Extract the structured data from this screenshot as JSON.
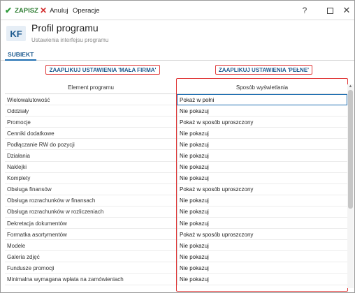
{
  "toolbar": {
    "save_label": "ZAPISZ",
    "cancel_label": "Anuluj",
    "operations_label": "Operacje",
    "help_label": "?"
  },
  "header": {
    "badge": "KF",
    "title": "Profil programu",
    "subtitle": "Ustawienia interfejsu programu"
  },
  "tabs": [
    {
      "label": "SUBIEKT"
    }
  ],
  "actions": {
    "apply_small": "ZAAPLIKUJ USTAWIENIA 'MAŁA FIRMA'",
    "apply_full": "ZAAPLIKUJ USTAWIENIA 'PEŁNE'"
  },
  "grid": {
    "columns": [
      "Element programu",
      "Sposób wyświetlania"
    ],
    "rows": [
      {
        "element": "Wielowalutowość",
        "mode": "Pokaż w pełni"
      },
      {
        "element": "Oddziały",
        "mode": "Nie pokazuj"
      },
      {
        "element": "Promocje",
        "mode": "Pokaż w sposób uproszczony"
      },
      {
        "element": "Cenniki dodatkowe",
        "mode": "Nie pokazuj"
      },
      {
        "element": "Podłączanie RW do pozycji",
        "mode": "Nie pokazuj"
      },
      {
        "element": "Działania",
        "mode": "Nie pokazuj"
      },
      {
        "element": "Naklejki",
        "mode": "Nie pokazuj"
      },
      {
        "element": "Komplety",
        "mode": "Nie pokazuj"
      },
      {
        "element": "Obsługa finansów",
        "mode": "Pokaż w sposób uproszczony"
      },
      {
        "element": "Obsługa rozrachunków w finansach",
        "mode": "Nie pokazuj"
      },
      {
        "element": "Obsługa rozrachunków w rozliczeniach",
        "mode": "Nie pokazuj"
      },
      {
        "element": "Dekretacja dokumentów",
        "mode": "Nie pokazuj"
      },
      {
        "element": "Formatka asortymentów",
        "mode": "Pokaż w sposób uproszczony"
      },
      {
        "element": "Modele",
        "mode": "Nie pokazuj"
      },
      {
        "element": "Galeria zdjęć",
        "mode": "Nie pokazuj"
      },
      {
        "element": "Fundusze promocji",
        "mode": "Nie pokazuj"
      },
      {
        "element": "Minimalna wymagana wpłata na zamówieniach",
        "mode": "Nie pokazuj"
      }
    ]
  }
}
